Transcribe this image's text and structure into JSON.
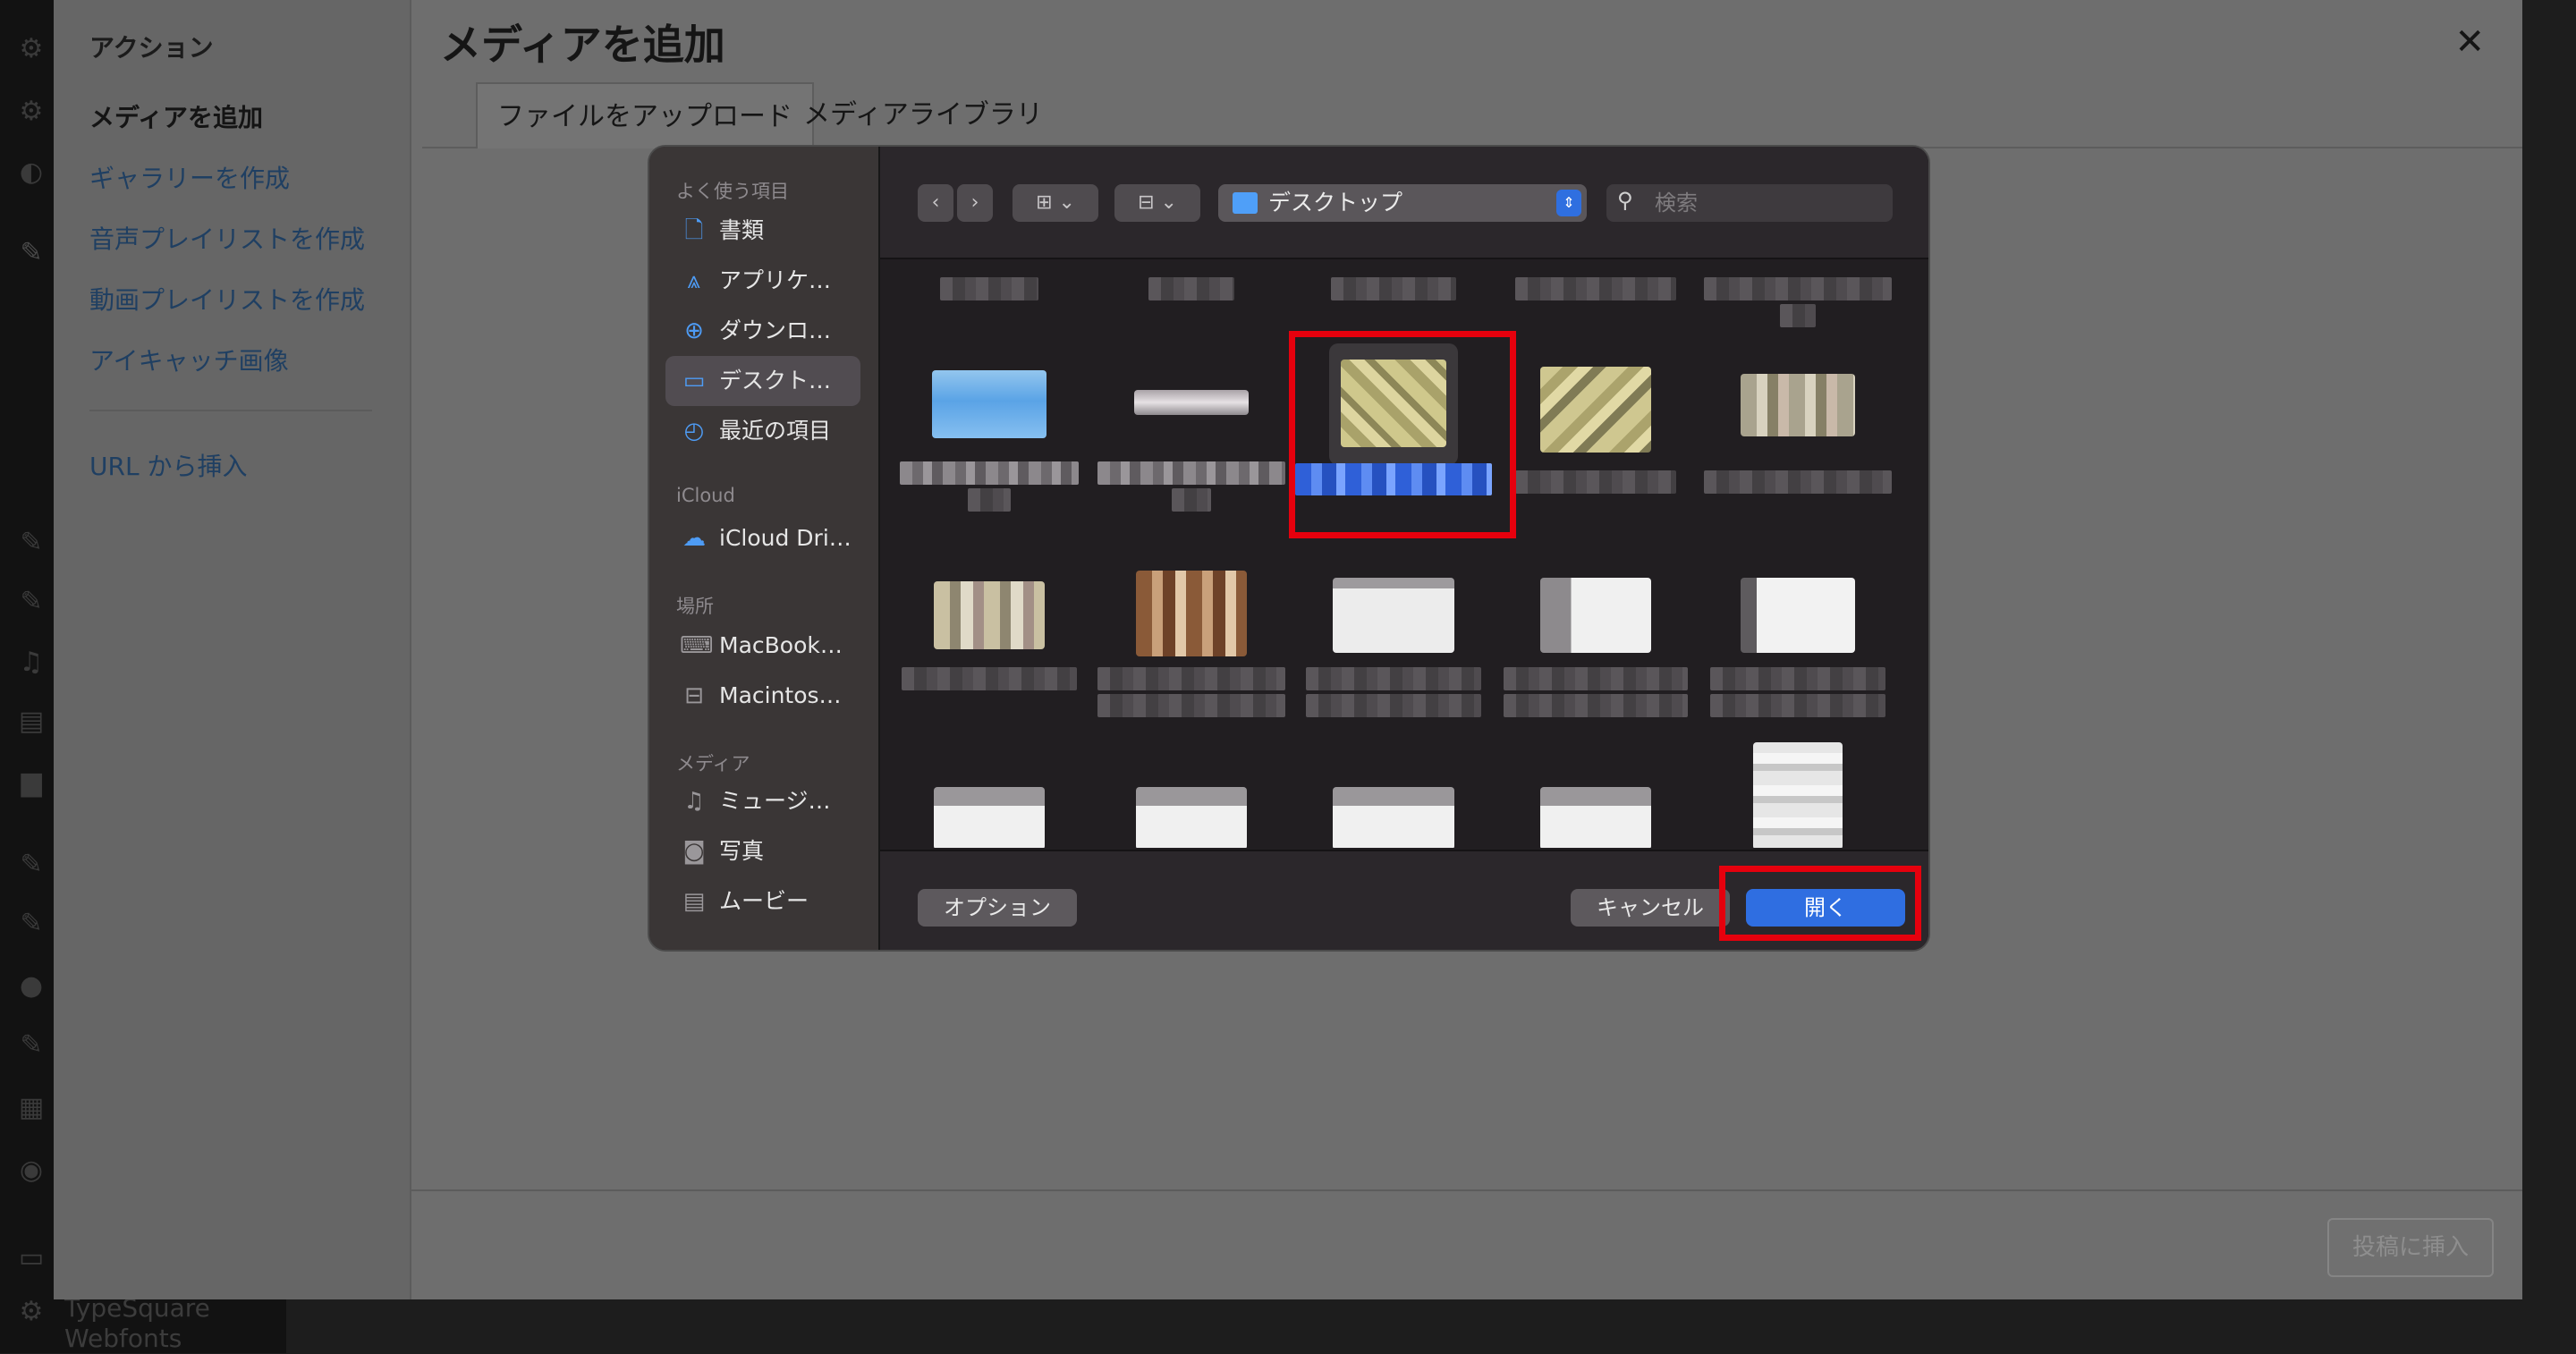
{
  "wp_sidebar": {
    "plugin_label_line1": "TypeSquare",
    "plugin_label_line2": "Webfonts"
  },
  "media_modal": {
    "title": "メディアを追加",
    "close_icon": "close-icon",
    "menu": {
      "heading": "アクション",
      "items": [
        {
          "label": "メディアを追加",
          "active": true
        },
        {
          "label": "ギャラリーを作成",
          "active": false
        },
        {
          "label": "音声プレイリストを作成",
          "active": false
        },
        {
          "label": "動画プレイリストを作成",
          "active": false
        },
        {
          "label": "アイキャッチ画像",
          "active": false
        }
      ],
      "url_insert": "URL から挿入"
    },
    "tabs": [
      {
        "label": "ファイルをアップロード",
        "selected": true
      },
      {
        "label": "メディアライブラリ",
        "selected": false
      }
    ],
    "insert_button": "投稿に挿入"
  },
  "file_dialog": {
    "sidebar": {
      "favorites_header": "よく使う項目",
      "favorites": [
        {
          "label": "書類",
          "icon": "document-icon"
        },
        {
          "label": "アプリケ…",
          "icon": "applications-icon"
        },
        {
          "label": "ダウンロ…",
          "icon": "download-icon"
        },
        {
          "label": "デスクト…",
          "icon": "desktop-icon",
          "selected": true
        },
        {
          "label": "最近の項目",
          "icon": "clock-icon"
        }
      ],
      "icloud_header": "iCloud",
      "icloud": [
        {
          "label": "iCloud Dri…",
          "icon": "cloud-icon"
        }
      ],
      "locations_header": "場所",
      "locations": [
        {
          "label": "MacBook…",
          "icon": "laptop-icon"
        },
        {
          "label": "Macintos…",
          "icon": "disk-icon"
        }
      ],
      "media_header": "メディア",
      "media": [
        {
          "label": "ミュージ…",
          "icon": "music-icon"
        },
        {
          "label": "写真",
          "icon": "camera-icon"
        },
        {
          "label": "ムービー",
          "icon": "film-icon"
        }
      ]
    },
    "toolbar": {
      "back_icon": "chevron-left-icon",
      "forward_icon": "chevron-right-icon",
      "view_mode_icon": "grid-view-icon",
      "group_icon": "group-icon",
      "current_folder": "デスクトップ",
      "search_placeholder": "検索"
    },
    "buttons": {
      "options": "オプション",
      "cancel": "キャンセル",
      "open": "開く"
    },
    "colors": {
      "accent": "#2f6ee1",
      "highlight_box": "#e6000d"
    }
  }
}
